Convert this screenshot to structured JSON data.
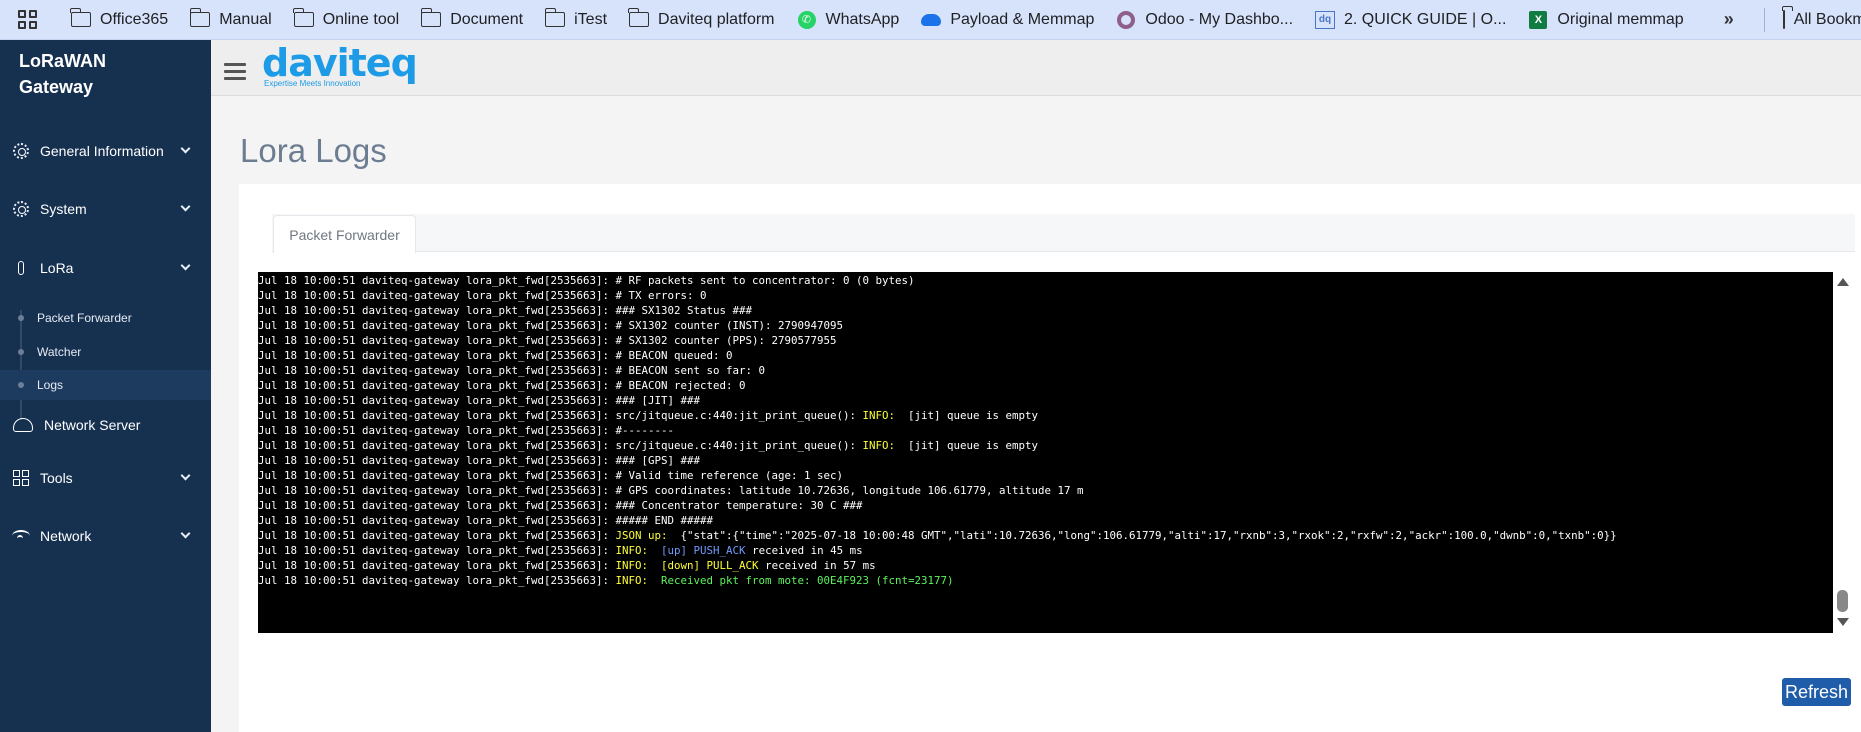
{
  "bookmarks": {
    "items": [
      {
        "label": "Office365",
        "icon": "folder-icon"
      },
      {
        "label": "Manual",
        "icon": "folder-icon"
      },
      {
        "label": "Online tool",
        "icon": "folder-icon"
      },
      {
        "label": "Document",
        "icon": "folder-icon"
      },
      {
        "label": "iTest",
        "icon": "folder-icon"
      },
      {
        "label": "Daviteq platform",
        "icon": "folder-icon"
      },
      {
        "label": "WhatsApp",
        "icon": "whatsapp-icon"
      },
      {
        "label": "Payload & Memmap",
        "icon": "cloud-icon"
      },
      {
        "label": "Odoo - My Dashbo...",
        "icon": "odoo-icon"
      },
      {
        "label": "2. QUICK GUIDE | O...",
        "icon": "dq-icon"
      },
      {
        "label": "Original memmap",
        "icon": "excel-icon"
      }
    ],
    "more": "»",
    "all_bookmarks": "All Bookmarks"
  },
  "sidebar": {
    "brand_line1": "LoRaWAN",
    "brand_line2": "Gateway",
    "items": [
      {
        "label": "General Information"
      },
      {
        "label": "System"
      },
      {
        "label": "LoRa"
      },
      {
        "label": "Network Server"
      },
      {
        "label": "Tools"
      },
      {
        "label": "Network"
      }
    ],
    "lora_sub": [
      {
        "label": "Packet Forwarder"
      },
      {
        "label": "Watcher"
      },
      {
        "label": "Logs"
      }
    ]
  },
  "header": {
    "logo": "daviteq",
    "tagline": "Expertise Meets Innovation"
  },
  "main": {
    "title": "Lora Logs",
    "tab": "Packet Forwarder",
    "refresh_label": "Refresh",
    "prefix": "Jul 18 10:00:51 daviteq-gateway lora_pkt_fwd[2535663]: ",
    "logs": [
      {
        "parts": [
          {
            "t": "# RF packets sent to concentrator: 0 (0 bytes)"
          }
        ]
      },
      {
        "parts": [
          {
            "t": "# TX errors: 0"
          }
        ]
      },
      {
        "parts": [
          {
            "t": "### SX1302 Status ###"
          }
        ]
      },
      {
        "parts": [
          {
            "t": "# SX1302 counter (INST): 2790947095"
          }
        ]
      },
      {
        "parts": [
          {
            "t": "# SX1302 counter (PPS): 2790577955"
          }
        ]
      },
      {
        "parts": [
          {
            "t": "# BEACON queued: 0"
          }
        ]
      },
      {
        "parts": [
          {
            "t": "# BEACON sent so far: 0"
          }
        ]
      },
      {
        "parts": [
          {
            "t": "# BEACON rejected: 0"
          }
        ]
      },
      {
        "parts": [
          {
            "t": "### [JIT] ###"
          }
        ]
      },
      {
        "parts": [
          {
            "t": "src/jitqueue.c:440:jit_print_queue(): "
          },
          {
            "t": "INFO:",
            "c": "tag"
          },
          {
            "t": "  [jit] queue is empty"
          }
        ]
      },
      {
        "parts": [
          {
            "t": "#--------"
          }
        ]
      },
      {
        "parts": [
          {
            "t": "src/jitqueue.c:440:jit_print_queue(): "
          },
          {
            "t": "INFO:",
            "c": "tag"
          },
          {
            "t": "  [jit] queue is empty"
          }
        ]
      },
      {
        "parts": [
          {
            "t": "### [GPS] ###"
          }
        ]
      },
      {
        "parts": [
          {
            "t": "# Valid time reference (age: 1 sec)"
          }
        ]
      },
      {
        "parts": [
          {
            "t": "# GPS coordinates: latitude 10.72636, longitude 106.61779, altitude 17 m"
          }
        ]
      },
      {
        "parts": [
          {
            "t": "### Concentrator temperature: 30 C ###"
          }
        ]
      },
      {
        "parts": [
          {
            "t": "##### END #####"
          }
        ]
      },
      {
        "parts": [
          {
            "t": "JSON up:",
            "c": "tag"
          },
          {
            "t": "  {\"stat\":{\"time\":\"2025-07-18 10:00:48 GMT\",\"lati\":10.72636,\"long\":106.61779,\"alti\":17,\"rxnb\":3,\"rxok\":2,\"rxfw\":2,\"ackr\":100.0,\"dwnb\":0,\"txnb\":0}}"
          }
        ]
      },
      {
        "parts": [
          {
            "t": "INFO:",
            "c": "tag"
          },
          {
            "t": "  "
          },
          {
            "t": "[up] PUSH_ACK",
            "c": "blue"
          },
          {
            "t": " received in 45 ms"
          }
        ]
      },
      {
        "parts": [
          {
            "t": "INFO:",
            "c": "tag"
          },
          {
            "t": "  "
          },
          {
            "t": "[down] PULL_ACK",
            "c": "tag"
          },
          {
            "t": " received in 57 ms"
          }
        ]
      },
      {
        "parts": [
          {
            "t": "INFO:",
            "c": "tag"
          },
          {
            "t": "  "
          },
          {
            "t": "Received pkt from mote: 00E4F923 (fcnt=23177)",
            "c": "green"
          }
        ]
      }
    ]
  },
  "colors": {
    "sidebar_bg": "#16304f",
    "accent": "#1d9be6",
    "button": "#1f5caa",
    "log_info": "#ffff39",
    "log_success": "#5df25d"
  }
}
